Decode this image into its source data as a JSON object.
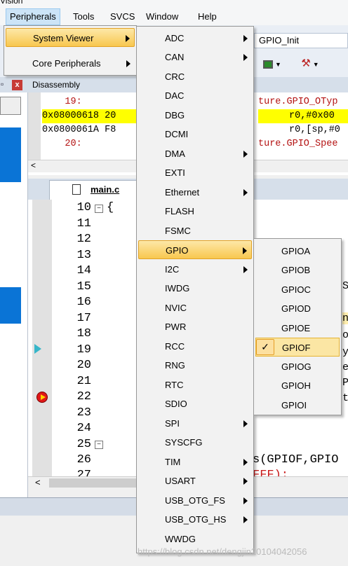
{
  "title_fragment": "Vision",
  "menubar": {
    "items": [
      "Peripherals",
      "Tools",
      "SVCS",
      "Window",
      "Help"
    ],
    "active": "Peripherals"
  },
  "toolbar": {
    "function_box": "GPIO_Init"
  },
  "disassembly": {
    "title": "Disassembly",
    "lines": [
      {
        "addr": "    19:",
        "src": "ture.GPIO_OTyp",
        "highlight": false,
        "kind": "src"
      },
      {
        "addr": "0x08000618 20",
        "src": "r0,#0x00",
        "highlight": true,
        "kind": "asm"
      },
      {
        "addr": "0x0800061A F8",
        "src": "r0,[sp,#0",
        "highlight": false,
        "kind": "asm"
      },
      {
        "addr": "    20:",
        "src": "ture.GPIO_Spee",
        "highlight": false,
        "kind": "src"
      }
    ]
  },
  "editor": {
    "tab_label": "main.c",
    "line_numbers": [
      "10",
      "11",
      "12",
      "13",
      "14",
      "15",
      "16",
      "17",
      "18",
      "19",
      "20",
      "21",
      "22",
      "23",
      "24",
      "25",
      "26",
      "27"
    ],
    "first_line_code": "{",
    "line26_code": "s(GPIOF,GPIO",
    "line27_code": "FFF);"
  },
  "peripherals_menu": {
    "items": [
      {
        "label": "System Viewer",
        "submenu": true,
        "highlighted": true
      },
      {
        "label": "Core Peripherals",
        "submenu": true,
        "highlighted": false
      }
    ]
  },
  "system_viewer_menu": {
    "items": [
      {
        "label": "ADC",
        "submenu": true
      },
      {
        "label": "CAN",
        "submenu": true
      },
      {
        "label": "CRC",
        "submenu": false
      },
      {
        "label": "DAC",
        "submenu": false
      },
      {
        "label": "DBG",
        "submenu": false
      },
      {
        "label": "DCMI",
        "submenu": false
      },
      {
        "label": "DMA",
        "submenu": true
      },
      {
        "label": "EXTI",
        "submenu": false
      },
      {
        "label": "Ethernet",
        "submenu": true
      },
      {
        "label": "FLASH",
        "submenu": false
      },
      {
        "label": "FSMC",
        "submenu": false
      },
      {
        "label": "GPIO",
        "submenu": true,
        "highlighted": true
      },
      {
        "label": "I2C",
        "submenu": true
      },
      {
        "label": "IWDG",
        "submenu": false
      },
      {
        "label": "NVIC",
        "submenu": false
      },
      {
        "label": "PWR",
        "submenu": false
      },
      {
        "label": "RCC",
        "submenu": false
      },
      {
        "label": "RNG",
        "submenu": false
      },
      {
        "label": "RTC",
        "submenu": false
      },
      {
        "label": "SDIO",
        "submenu": false
      },
      {
        "label": "SPI",
        "submenu": true
      },
      {
        "label": "SYSCFG",
        "submenu": false
      },
      {
        "label": "TIM",
        "submenu": true
      },
      {
        "label": "USART",
        "submenu": true
      },
      {
        "label": "USB_OTG_FS",
        "submenu": true
      },
      {
        "label": "USB_OTG_HS",
        "submenu": true
      },
      {
        "label": "WWDG",
        "submenu": false
      }
    ]
  },
  "gpio_menu": {
    "items": [
      {
        "label": "GPIOA",
        "checked": false
      },
      {
        "label": "GPIOB",
        "checked": false
      },
      {
        "label": "GPIOC",
        "checked": false
      },
      {
        "label": "GPIOD",
        "checked": false
      },
      {
        "label": "GPIOE",
        "checked": false
      },
      {
        "label": "GPIOF",
        "checked": true
      },
      {
        "label": "GPIOG",
        "checked": false
      },
      {
        "label": "GPIOH",
        "checked": false
      },
      {
        "label": "GPIOI",
        "checked": false
      }
    ],
    "check_glyph": "✓"
  },
  "right_text": [
    "S",
    "n",
    "o",
    "y",
    "e",
    "P",
    "t"
  ],
  "watermark": "https://blog.csdn.net/dengjin20104042056",
  "colors": {
    "menu_highlight": "#f8c74f",
    "selection_blue": "#0a74d6",
    "current_line": "#ffff00"
  }
}
